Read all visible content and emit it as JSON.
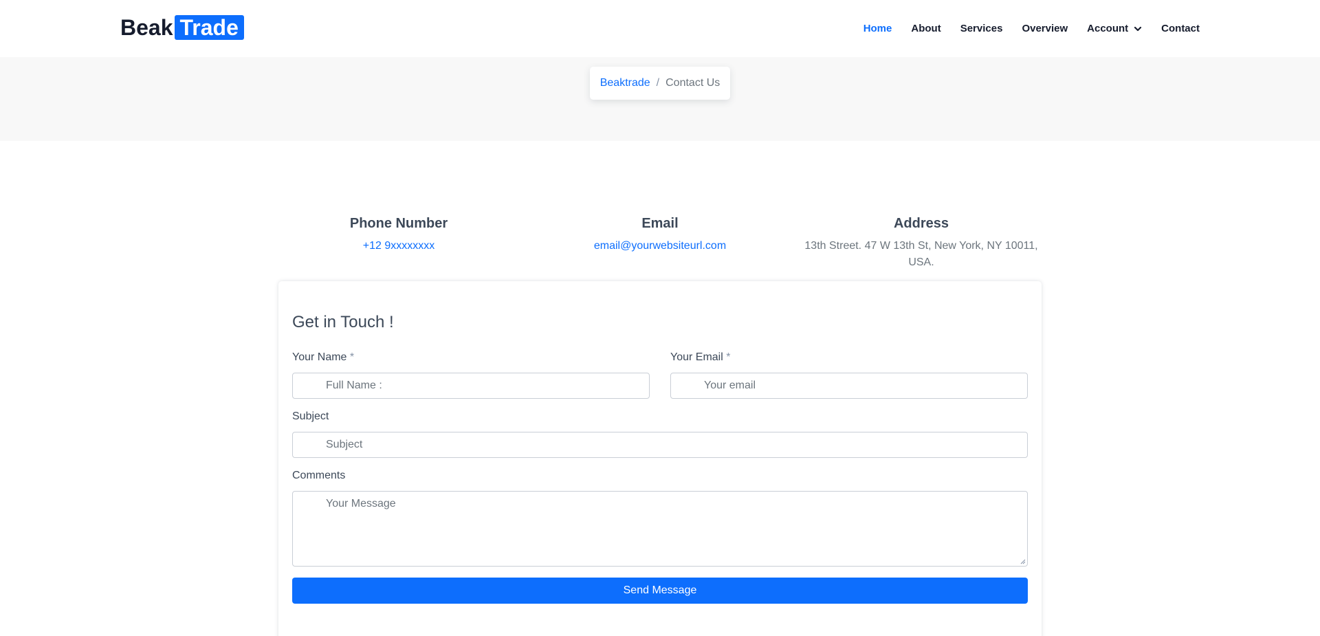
{
  "brand": {
    "part1": "Beak",
    "part2": "Trade",
    "accent": "#0d6efd"
  },
  "nav": {
    "items": [
      {
        "label": "Home",
        "active": true
      },
      {
        "label": "About"
      },
      {
        "label": "Services"
      },
      {
        "label": "Overview"
      },
      {
        "label": "Account",
        "dropdown": true,
        "icon": "chevron-down-icon"
      },
      {
        "label": "Contact"
      }
    ]
  },
  "breadcrumb": {
    "home": "Beaktrade",
    "separator": "/",
    "current": "Contact Us"
  },
  "contact": {
    "phone": {
      "title": "Phone Number",
      "value": "+12 9xxxxxxxx"
    },
    "email": {
      "title": "Email",
      "value": "email@yourwebsiteurl.com"
    },
    "address": {
      "title": "Address",
      "line1": "13th Street. 47 W 13th St, New York, NY 10011,",
      "line2": "USA."
    }
  },
  "form": {
    "title": "Get in Touch !",
    "name": {
      "label": "Your Name",
      "required": "*",
      "placeholder": "Full Name :"
    },
    "email": {
      "label": "Your Email",
      "required": "*",
      "placeholder": "Your email"
    },
    "subject": {
      "label": "Subject",
      "placeholder": "Subject"
    },
    "comments": {
      "label": "Comments",
      "placeholder": "Your Message"
    },
    "submit": "Send Message"
  }
}
